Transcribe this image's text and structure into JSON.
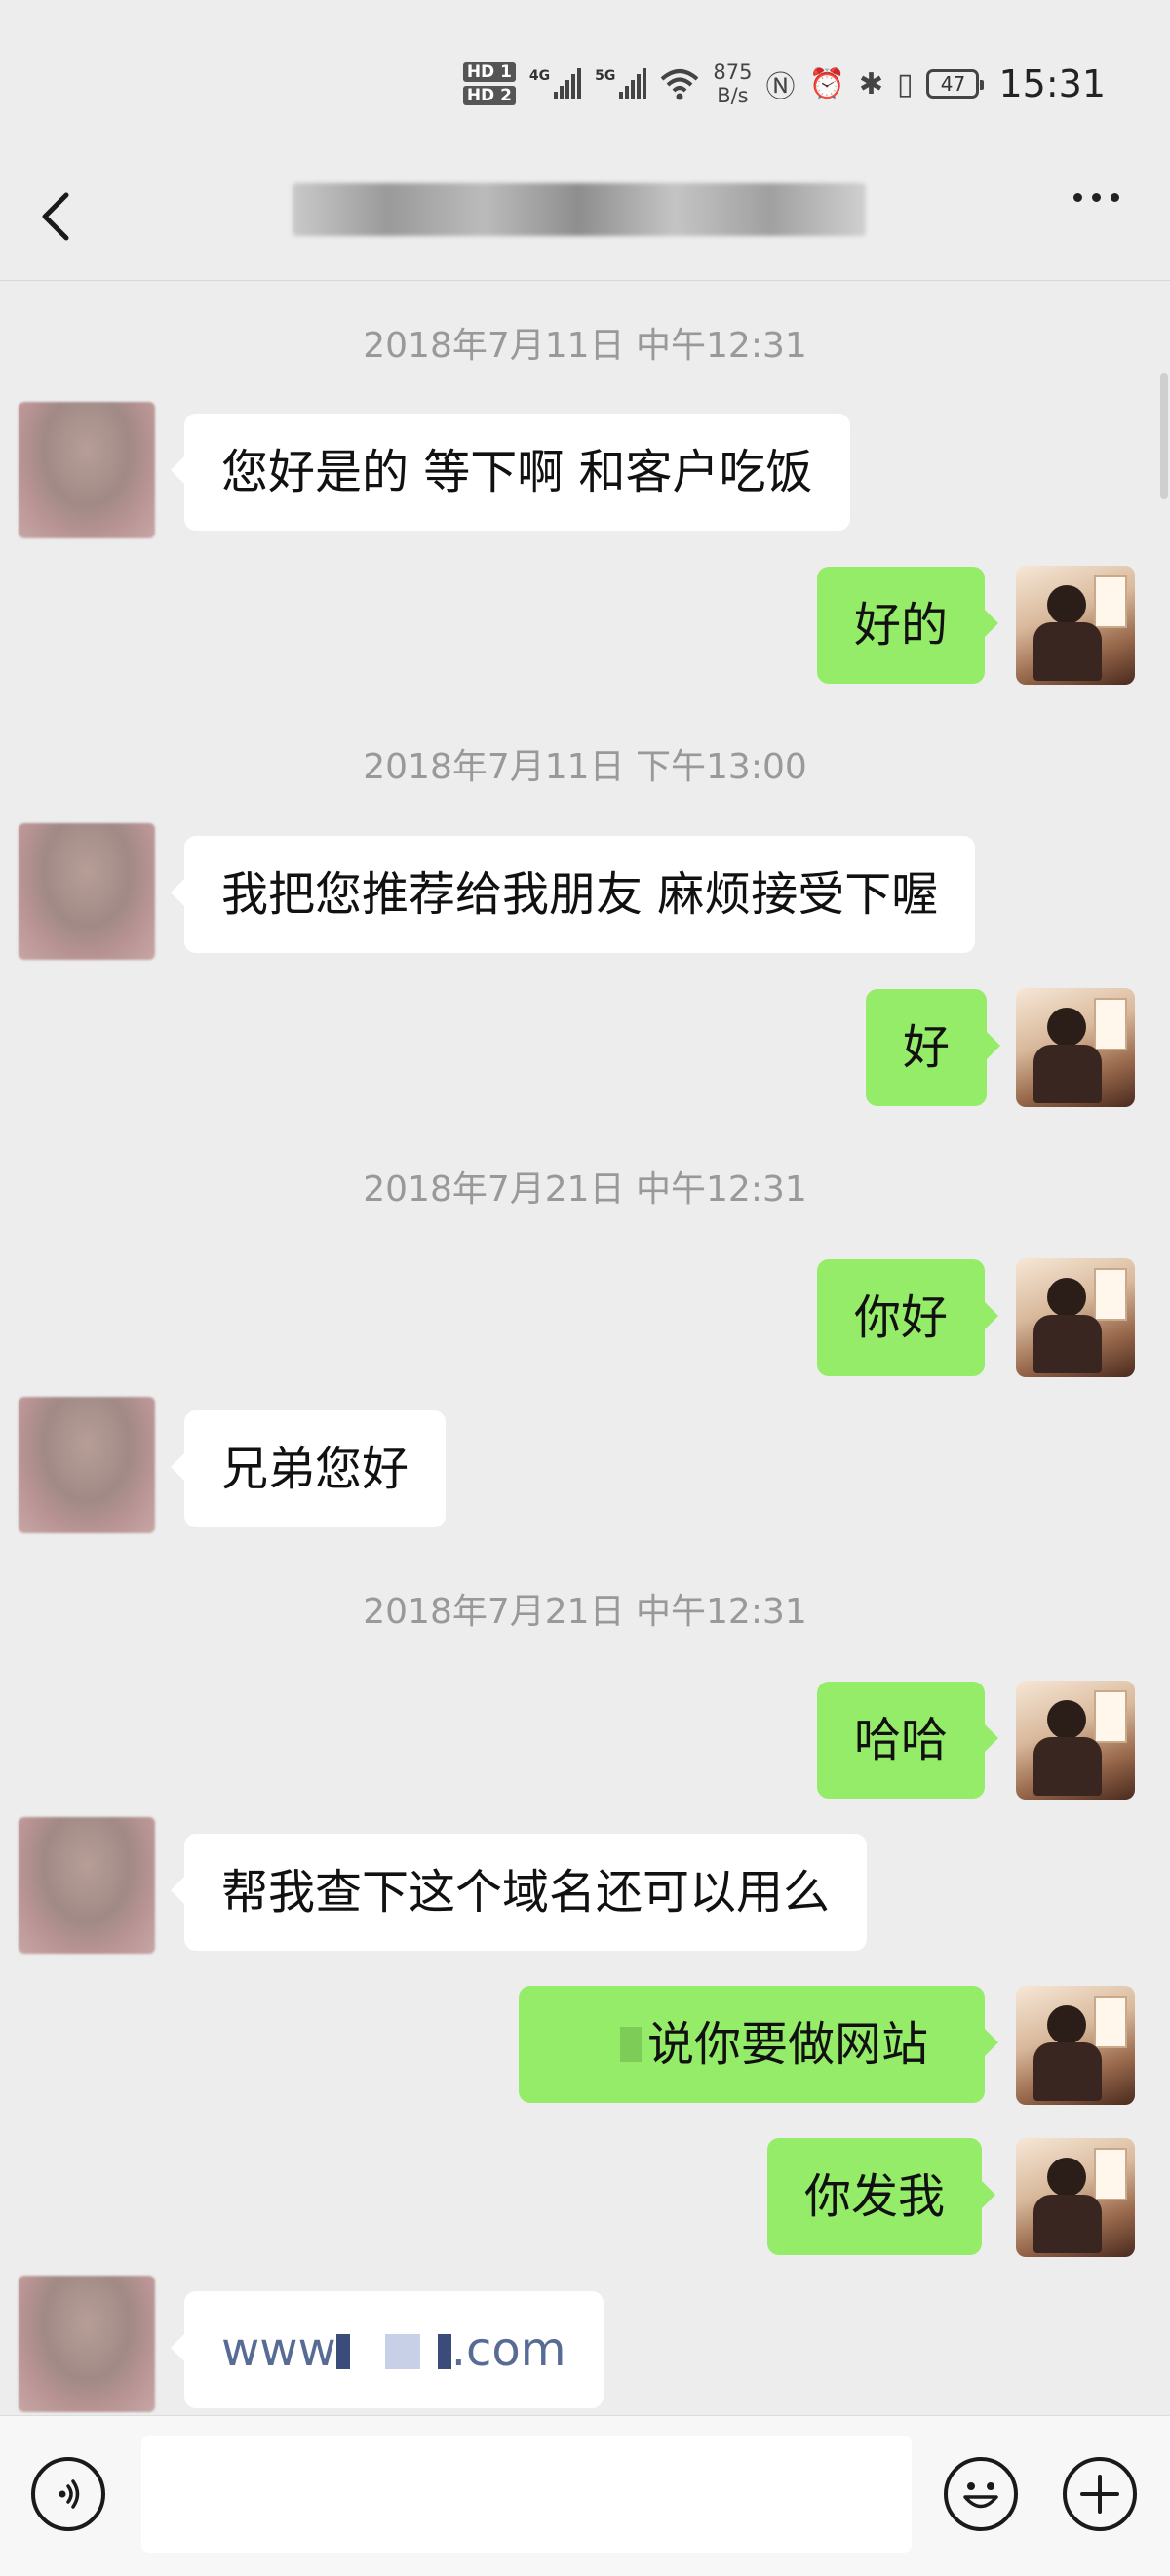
{
  "status_bar": {
    "hd1": "HD 1",
    "hd2": "HD 2",
    "net1": "4G",
    "net2": "5G",
    "speed_value": "875",
    "speed_unit": "B/s",
    "battery": "47",
    "time": "15:31"
  },
  "nav": {
    "back_icon": "chevron-left-icon",
    "title": "",
    "more_icon": "more-horizontal-icon"
  },
  "messages": [
    {
      "type": "timestamp",
      "text": "2018年7月11日 中午12:31"
    },
    {
      "type": "in",
      "text": "您好是的 等下啊 和客户吃饭"
    },
    {
      "type": "out",
      "text": "好的"
    },
    {
      "type": "timestamp",
      "text": "2018年7月11日 下午13:00"
    },
    {
      "type": "in",
      "text": "我把您推荐给我朋友 麻烦接受下喔"
    },
    {
      "type": "out",
      "text": "好"
    },
    {
      "type": "timestamp",
      "text": "2018年7月21日 中午12:31"
    },
    {
      "type": "out",
      "text": "你好"
    },
    {
      "type": "in",
      "text": "兄弟您好"
    },
    {
      "type": "timestamp",
      "text": "2018年7月21日 中午12:31"
    },
    {
      "type": "out",
      "text": "哈哈"
    },
    {
      "type": "in",
      "text": "帮我查下这个域名还可以用么"
    },
    {
      "type": "out",
      "text": "说你要做网站"
    },
    {
      "type": "out",
      "text": "你发我"
    },
    {
      "type": "in",
      "text_prefix": "www",
      "text_suffix": ".com"
    }
  ],
  "bottom": {
    "voice_icon": "voice-icon",
    "input_placeholder": "",
    "emoji_icon": "emoji-icon",
    "plus_icon": "plus-icon"
  },
  "colors": {
    "outgoing_bubble": "#95ec69",
    "incoming_bubble": "#ffffff",
    "background": "#ededed",
    "link": "#576b95"
  }
}
